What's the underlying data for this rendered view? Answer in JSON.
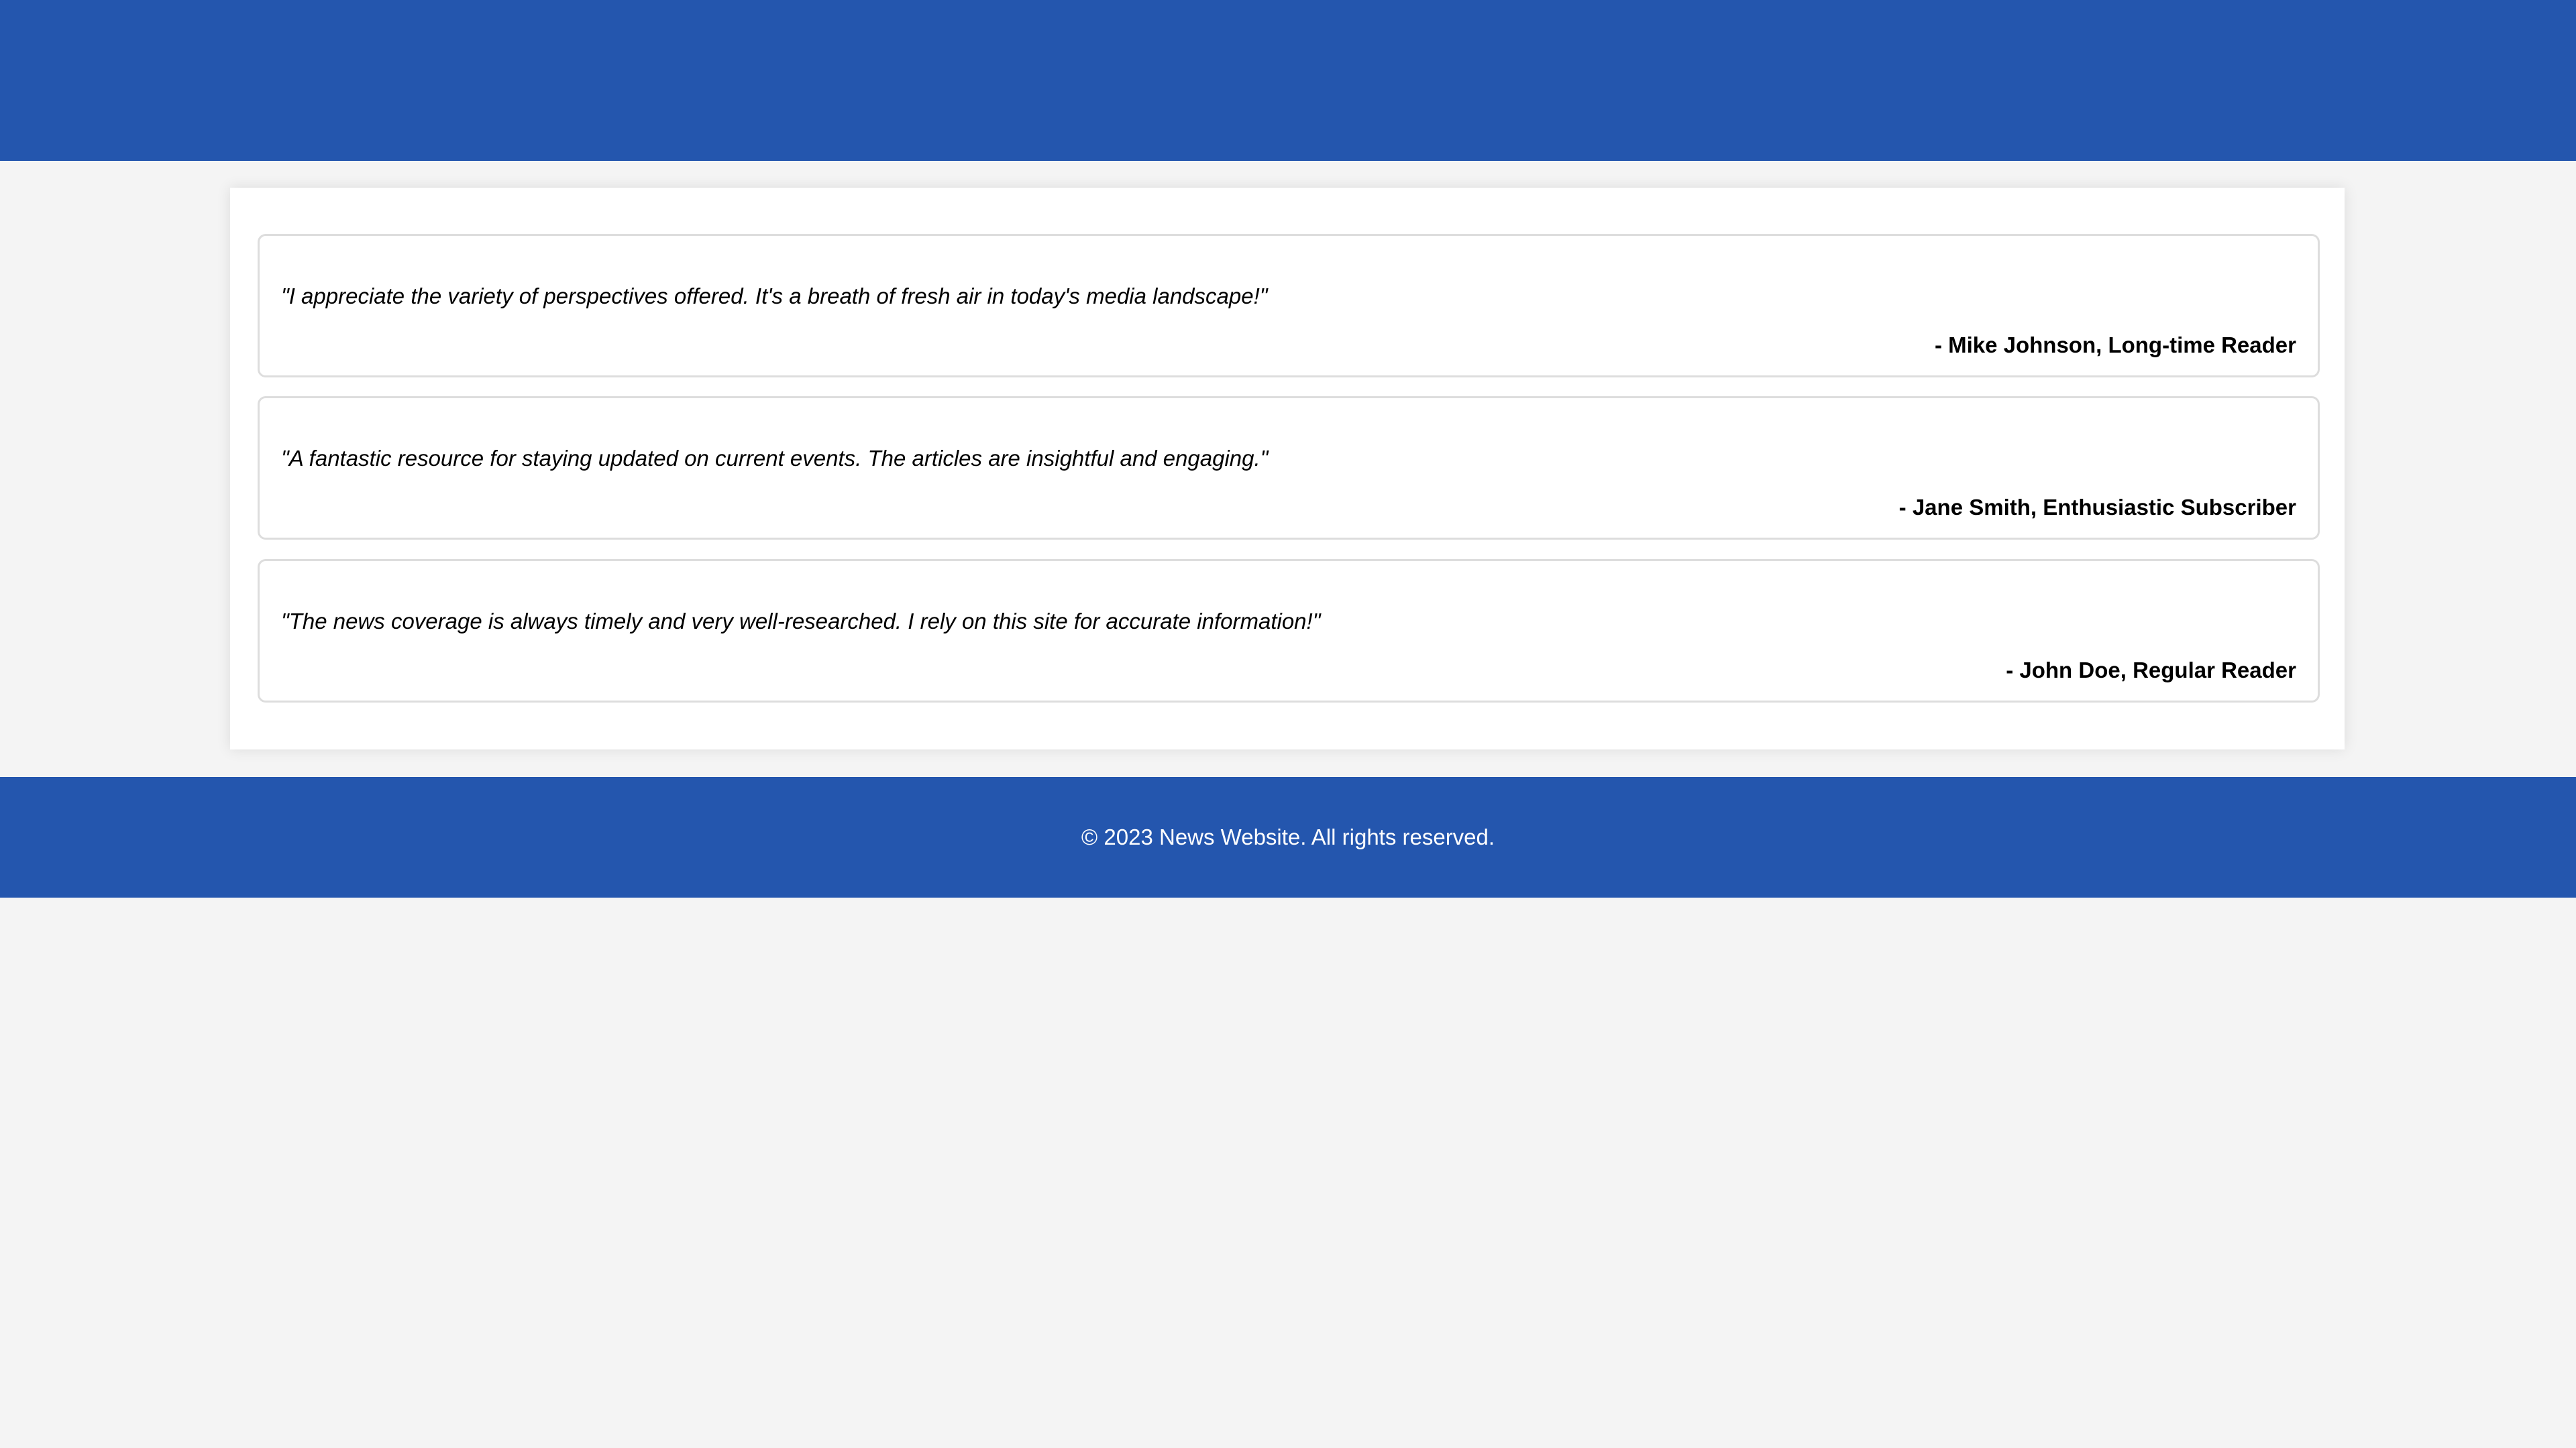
{
  "colors": {
    "brand_blue": "#2456ae",
    "page_background": "#f4f4f4",
    "card_background": "#ffffff",
    "testimonial_border": "#dddddd",
    "footer_text": "#ffffff"
  },
  "testimonials": [
    {
      "quote": "\"I appreciate the variety of perspectives offered. It's a breath of fresh air in today's media landscape!\"",
      "author": "- Mike Johnson, Long-time Reader"
    },
    {
      "quote": "\"A fantastic resource for staying updated on current events. The articles are insightful and engaging.\"",
      "author": "- Jane Smith, Enthusiastic Subscriber"
    },
    {
      "quote": "\"The news coverage is always timely and very well-researched. I rely on this site for accurate information!\"",
      "author": "- John Doe, Regular Reader"
    }
  ],
  "footer": {
    "text": "© 2023 News Website. All rights reserved."
  }
}
